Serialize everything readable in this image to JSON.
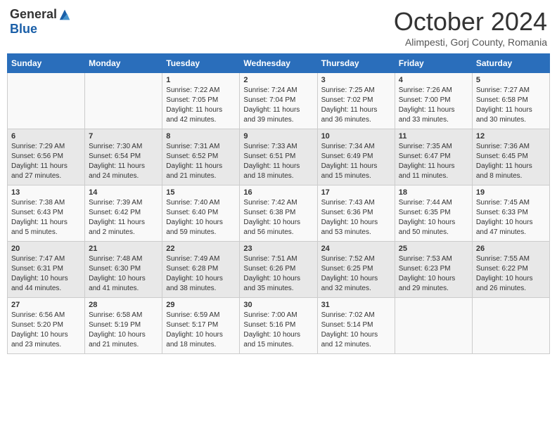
{
  "logo": {
    "general": "General",
    "blue": "Blue"
  },
  "title": "October 2024",
  "location": "Alimpesti, Gorj County, Romania",
  "days_of_week": [
    "Sunday",
    "Monday",
    "Tuesday",
    "Wednesday",
    "Thursday",
    "Friday",
    "Saturday"
  ],
  "weeks": [
    [
      {
        "day": "",
        "info": ""
      },
      {
        "day": "",
        "info": ""
      },
      {
        "day": "1",
        "sunrise": "Sunrise: 7:22 AM",
        "sunset": "Sunset: 7:05 PM",
        "daylight": "Daylight: 11 hours and 42 minutes."
      },
      {
        "day": "2",
        "sunrise": "Sunrise: 7:24 AM",
        "sunset": "Sunset: 7:04 PM",
        "daylight": "Daylight: 11 hours and 39 minutes."
      },
      {
        "day": "3",
        "sunrise": "Sunrise: 7:25 AM",
        "sunset": "Sunset: 7:02 PM",
        "daylight": "Daylight: 11 hours and 36 minutes."
      },
      {
        "day": "4",
        "sunrise": "Sunrise: 7:26 AM",
        "sunset": "Sunset: 7:00 PM",
        "daylight": "Daylight: 11 hours and 33 minutes."
      },
      {
        "day": "5",
        "sunrise": "Sunrise: 7:27 AM",
        "sunset": "Sunset: 6:58 PM",
        "daylight": "Daylight: 11 hours and 30 minutes."
      }
    ],
    [
      {
        "day": "6",
        "sunrise": "Sunrise: 7:29 AM",
        "sunset": "Sunset: 6:56 PM",
        "daylight": "Daylight: 11 hours and 27 minutes."
      },
      {
        "day": "7",
        "sunrise": "Sunrise: 7:30 AM",
        "sunset": "Sunset: 6:54 PM",
        "daylight": "Daylight: 11 hours and 24 minutes."
      },
      {
        "day": "8",
        "sunrise": "Sunrise: 7:31 AM",
        "sunset": "Sunset: 6:52 PM",
        "daylight": "Daylight: 11 hours and 21 minutes."
      },
      {
        "day": "9",
        "sunrise": "Sunrise: 7:33 AM",
        "sunset": "Sunset: 6:51 PM",
        "daylight": "Daylight: 11 hours and 18 minutes."
      },
      {
        "day": "10",
        "sunrise": "Sunrise: 7:34 AM",
        "sunset": "Sunset: 6:49 PM",
        "daylight": "Daylight: 11 hours and 15 minutes."
      },
      {
        "day": "11",
        "sunrise": "Sunrise: 7:35 AM",
        "sunset": "Sunset: 6:47 PM",
        "daylight": "Daylight: 11 hours and 11 minutes."
      },
      {
        "day": "12",
        "sunrise": "Sunrise: 7:36 AM",
        "sunset": "Sunset: 6:45 PM",
        "daylight": "Daylight: 11 hours and 8 minutes."
      }
    ],
    [
      {
        "day": "13",
        "sunrise": "Sunrise: 7:38 AM",
        "sunset": "Sunset: 6:43 PM",
        "daylight": "Daylight: 11 hours and 5 minutes."
      },
      {
        "day": "14",
        "sunrise": "Sunrise: 7:39 AM",
        "sunset": "Sunset: 6:42 PM",
        "daylight": "Daylight: 11 hours and 2 minutes."
      },
      {
        "day": "15",
        "sunrise": "Sunrise: 7:40 AM",
        "sunset": "Sunset: 6:40 PM",
        "daylight": "Daylight: 10 hours and 59 minutes."
      },
      {
        "day": "16",
        "sunrise": "Sunrise: 7:42 AM",
        "sunset": "Sunset: 6:38 PM",
        "daylight": "Daylight: 10 hours and 56 minutes."
      },
      {
        "day": "17",
        "sunrise": "Sunrise: 7:43 AM",
        "sunset": "Sunset: 6:36 PM",
        "daylight": "Daylight: 10 hours and 53 minutes."
      },
      {
        "day": "18",
        "sunrise": "Sunrise: 7:44 AM",
        "sunset": "Sunset: 6:35 PM",
        "daylight": "Daylight: 10 hours and 50 minutes."
      },
      {
        "day": "19",
        "sunrise": "Sunrise: 7:45 AM",
        "sunset": "Sunset: 6:33 PM",
        "daylight": "Daylight: 10 hours and 47 minutes."
      }
    ],
    [
      {
        "day": "20",
        "sunrise": "Sunrise: 7:47 AM",
        "sunset": "Sunset: 6:31 PM",
        "daylight": "Daylight: 10 hours and 44 minutes."
      },
      {
        "day": "21",
        "sunrise": "Sunrise: 7:48 AM",
        "sunset": "Sunset: 6:30 PM",
        "daylight": "Daylight: 10 hours and 41 minutes."
      },
      {
        "day": "22",
        "sunrise": "Sunrise: 7:49 AM",
        "sunset": "Sunset: 6:28 PM",
        "daylight": "Daylight: 10 hours and 38 minutes."
      },
      {
        "day": "23",
        "sunrise": "Sunrise: 7:51 AM",
        "sunset": "Sunset: 6:26 PM",
        "daylight": "Daylight: 10 hours and 35 minutes."
      },
      {
        "day": "24",
        "sunrise": "Sunrise: 7:52 AM",
        "sunset": "Sunset: 6:25 PM",
        "daylight": "Daylight: 10 hours and 32 minutes."
      },
      {
        "day": "25",
        "sunrise": "Sunrise: 7:53 AM",
        "sunset": "Sunset: 6:23 PM",
        "daylight": "Daylight: 10 hours and 29 minutes."
      },
      {
        "day": "26",
        "sunrise": "Sunrise: 7:55 AM",
        "sunset": "Sunset: 6:22 PM",
        "daylight": "Daylight: 10 hours and 26 minutes."
      }
    ],
    [
      {
        "day": "27",
        "sunrise": "Sunrise: 6:56 AM",
        "sunset": "Sunset: 5:20 PM",
        "daylight": "Daylight: 10 hours and 23 minutes."
      },
      {
        "day": "28",
        "sunrise": "Sunrise: 6:58 AM",
        "sunset": "Sunset: 5:19 PM",
        "daylight": "Daylight: 10 hours and 21 minutes."
      },
      {
        "day": "29",
        "sunrise": "Sunrise: 6:59 AM",
        "sunset": "Sunset: 5:17 PM",
        "daylight": "Daylight: 10 hours and 18 minutes."
      },
      {
        "day": "30",
        "sunrise": "Sunrise: 7:00 AM",
        "sunset": "Sunset: 5:16 PM",
        "daylight": "Daylight: 10 hours and 15 minutes."
      },
      {
        "day": "31",
        "sunrise": "Sunrise: 7:02 AM",
        "sunset": "Sunset: 5:14 PM",
        "daylight": "Daylight: 10 hours and 12 minutes."
      },
      {
        "day": "",
        "info": ""
      },
      {
        "day": "",
        "info": ""
      }
    ]
  ]
}
